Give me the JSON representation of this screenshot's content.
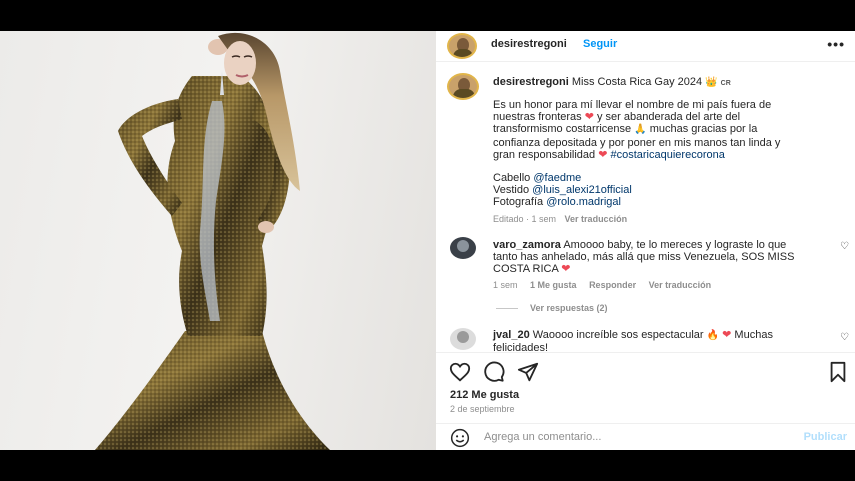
{
  "post": {
    "username": "desirestregoni",
    "follow_label": "Seguir",
    "more_label": "•••",
    "caption_title": "Miss Costa Rica Gay 2024",
    "crown": "👑",
    "flag": "CR",
    "caption_p1a": "Es un honor para mí llevar el nombre de mi país fuera de nuestras fronteras",
    "caption_p1b": "y ser abanderada del arte del transformismo costarricense",
    "caption_p1c": "muchas gracias por la confianza depositada y por poner en mis manos tan linda y gran responsabilidad",
    "hashtag": "#costaricaquierecorona",
    "credit_hair_label": "Cabello",
    "credit_hair": "@faedme",
    "credit_dress_label": "Vestido",
    "credit_dress": "@luis_alexi21official",
    "credit_photo_label": "Fotografía",
    "credit_photo": "@rolo.madrigal",
    "edited": "Editado · 1 sem",
    "see_translation": "Ver traducción",
    "heart": "❤",
    "pray": "🙏"
  },
  "comments": [
    {
      "username": "varo_zamora",
      "text": "Amoooo baby, te lo mereces y lograste lo que tanto has anhelado, más allá que miss Venezuela, SOS MISS COSTA RICA",
      "time": "1 sem",
      "likes": "1 Me gusta",
      "reply": "Responder",
      "translate": "Ver traducción",
      "view_replies": "Ver respuestas (2)"
    },
    {
      "username": "jval_20",
      "text": "Waoooo increíble sos espectacular",
      "text2": "Muchas felicidades!",
      "fire": "🔥"
    }
  ],
  "footer": {
    "likes": "212 Me gusta",
    "date": "2 de septiembre",
    "comment_placeholder": "Agrega un comentario...",
    "publish": "Publicar"
  },
  "colors": {
    "link_blue": "#0095f6",
    "mention": "#00376b",
    "heart_red": "#ed4956"
  }
}
